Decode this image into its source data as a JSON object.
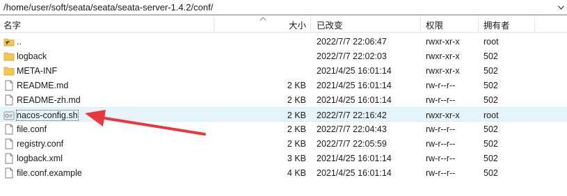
{
  "path": "/home/user/soft/seata/seata/seata-server-1.4.2/conf/",
  "columns": {
    "name": "名字",
    "size": "大小",
    "modified": "已改变",
    "permissions": "权限",
    "owner": "拥有者"
  },
  "files": [
    {
      "name": "..",
      "type": "parent",
      "size": "",
      "modified": "2022/7/7 22:06:47",
      "permissions": "rwxr-xr-x",
      "owner": "root"
    },
    {
      "name": "logback",
      "type": "folder",
      "size": "",
      "modified": "2022/7/7 22:02:03",
      "permissions": "rwxr-xr-x",
      "owner": "502"
    },
    {
      "name": "META-INF",
      "type": "folder",
      "size": "",
      "modified": "2021/4/25 16:01:14",
      "permissions": "rwxr-xr-x",
      "owner": "502"
    },
    {
      "name": "README.md",
      "type": "file",
      "size": "2 KB",
      "modified": "2021/4/25 16:01:14",
      "permissions": "rw-r--r--",
      "owner": "502"
    },
    {
      "name": "README-zh.md",
      "type": "file",
      "size": "2 KB",
      "modified": "2021/4/25 16:01:14",
      "permissions": "rw-r--r--",
      "owner": "502"
    },
    {
      "name": "nacos-config.sh",
      "type": "script",
      "size": "2 KB",
      "modified": "2022/7/7 22:16:42",
      "permissions": "rwxr-xr-x",
      "owner": "root"
    },
    {
      "name": "file.conf",
      "type": "file",
      "size": "2 KB",
      "modified": "2022/7/7 22:04:43",
      "permissions": "rw-r--r--",
      "owner": "502"
    },
    {
      "name": "registry.conf",
      "type": "file",
      "size": "2 KB",
      "modified": "2022/7/7 22:05:59",
      "permissions": "rw-r--r--",
      "owner": "502"
    },
    {
      "name": "logback.xml",
      "type": "file",
      "size": "3 KB",
      "modified": "2021/4/25 16:01:14",
      "permissions": "rw-r--r--",
      "owner": "502"
    },
    {
      "name": "file.conf.example",
      "type": "file",
      "size": "4 KB",
      "modified": "2021/4/25 16:01:14",
      "permissions": "rw-r--r--",
      "owner": "502"
    }
  ],
  "selected_file": "nacos-config.sh",
  "colors": {
    "selection": "#e5f3fb",
    "folder": "#f3c94b",
    "arrow": "#e8383d"
  },
  "icons": {
    "parent": "parent-directory-icon",
    "folder": "folder-icon",
    "file": "file-icon",
    "script": "script-file-icon",
    "sort": "sort-ascending-icon",
    "dropdown": "chevron-down-icon",
    "annotation": "red-arrow-annotation"
  }
}
